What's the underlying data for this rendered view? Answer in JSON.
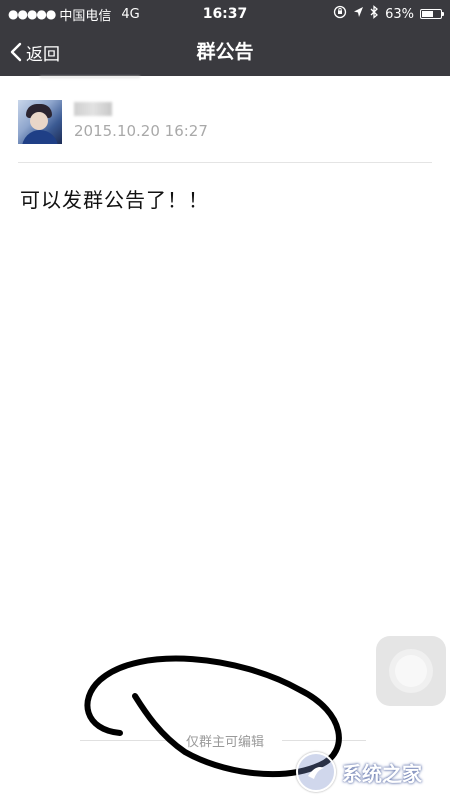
{
  "status_bar": {
    "signal": "●●●●●",
    "carrier": "中国电信",
    "network": "4G",
    "time": "16:37",
    "battery_percent": "63%",
    "battery_level": 0.63
  },
  "nav": {
    "back_label": "返回",
    "title": "群公告"
  },
  "announcement": {
    "timestamp": "2015.10.20  16:27",
    "content": "可以发群公告了！！"
  },
  "footer": {
    "note": "仅群主可编辑"
  },
  "watermark": {
    "text": "系统之家"
  },
  "colors": {
    "nav_background": "#3a3a3f",
    "annotation_ink": "#000000"
  },
  "icons": [
    "chevron-left-icon",
    "rotation-lock-icon",
    "location-arrow-icon",
    "bluetooth-icon",
    "battery-icon",
    "assistive-touch-icon"
  ]
}
